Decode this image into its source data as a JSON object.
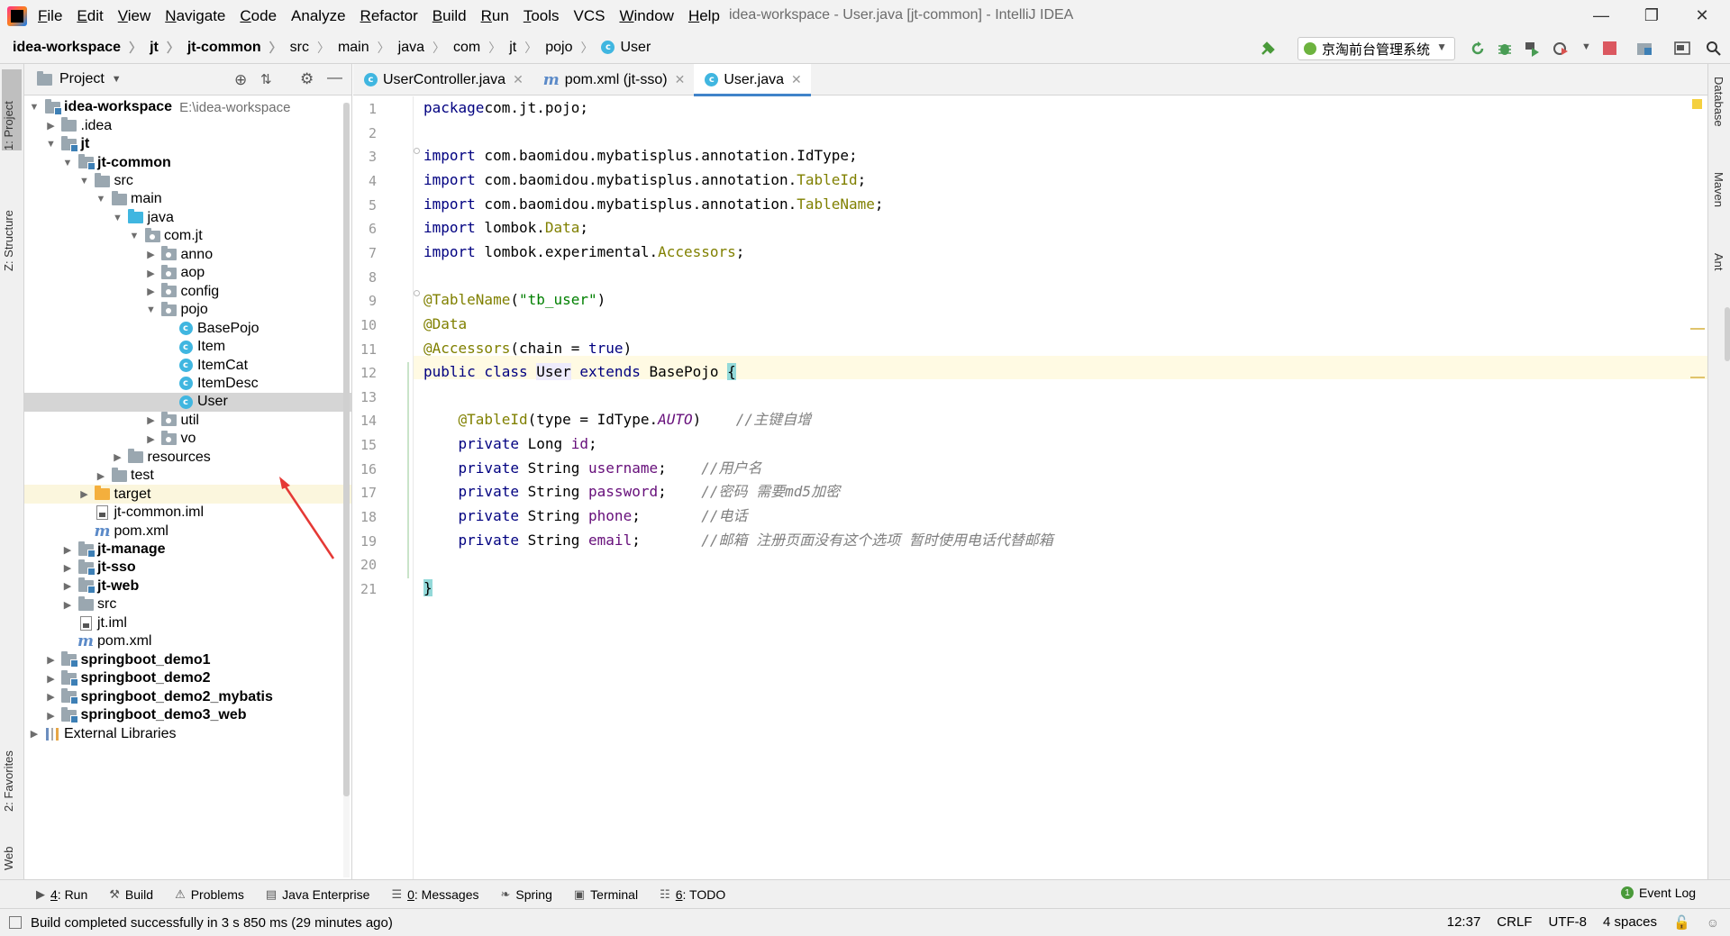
{
  "menubar": {
    "items": [
      {
        "u": "F",
        "rest": "ile"
      },
      {
        "u": "E",
        "rest": "dit"
      },
      {
        "u": "V",
        "rest": "iew"
      },
      {
        "u": "N",
        "rest": "avigate"
      },
      {
        "u": "C",
        "rest": "ode"
      },
      {
        "u": "",
        "rest": "Analyze"
      },
      {
        "u": "R",
        "rest": "efactor"
      },
      {
        "u": "B",
        "rest": "uild"
      },
      {
        "u": "R",
        "rest": "un"
      },
      {
        "u": "T",
        "rest": "ools"
      },
      {
        "u": "",
        "rest": "VCS"
      },
      {
        "u": "W",
        "rest": "indow"
      },
      {
        "u": "H",
        "rest": "elp"
      }
    ],
    "window_title": "idea-workspace - User.java [jt-common] - IntelliJ IDEA"
  },
  "navbar": {
    "breadcrumbs": [
      "idea-workspace",
      "jt",
      "jt-common",
      "src",
      "main",
      "java",
      "com",
      "jt",
      "pojo",
      "User"
    ],
    "run_config": "京淘前台管理系统"
  },
  "left_strip": {
    "project": "1: Project",
    "structure": "Z: Structure",
    "favorites": "2: Favorites",
    "web": "Web"
  },
  "right_strip": {
    "database": "Database",
    "maven": "Maven",
    "ant": "Ant"
  },
  "project_panel": {
    "title": "Project",
    "tree": [
      {
        "label": "idea-workspace",
        "path": "E:\\idea-workspace",
        "bold": true,
        "depth": 0,
        "arrow": "open",
        "icon": "module"
      },
      {
        "label": ".idea",
        "depth": 1,
        "arrow": "closed",
        "icon": "folder"
      },
      {
        "label": "jt",
        "bold": true,
        "depth": 1,
        "arrow": "open",
        "icon": "module"
      },
      {
        "label": "jt-common",
        "bold": true,
        "depth": 2,
        "arrow": "open",
        "icon": "module"
      },
      {
        "label": "src",
        "depth": 3,
        "arrow": "open",
        "icon": "folder"
      },
      {
        "label": "main",
        "depth": 4,
        "arrow": "open",
        "icon": "folder"
      },
      {
        "label": "java",
        "depth": 5,
        "arrow": "open",
        "icon": "folder-blue"
      },
      {
        "label": "com.jt",
        "depth": 6,
        "arrow": "open",
        "icon": "package"
      },
      {
        "label": "anno",
        "depth": 7,
        "arrow": "closed",
        "icon": "package"
      },
      {
        "label": "aop",
        "depth": 7,
        "arrow": "closed",
        "icon": "package"
      },
      {
        "label": "config",
        "depth": 7,
        "arrow": "closed",
        "icon": "package"
      },
      {
        "label": "pojo",
        "depth": 7,
        "arrow": "open",
        "icon": "package"
      },
      {
        "label": "BasePojo",
        "depth": 8,
        "arrow": "",
        "icon": "class"
      },
      {
        "label": "Item",
        "depth": 8,
        "arrow": "",
        "icon": "class"
      },
      {
        "label": "ItemCat",
        "depth": 8,
        "arrow": "",
        "icon": "class"
      },
      {
        "label": "ItemDesc",
        "depth": 8,
        "arrow": "",
        "icon": "class"
      },
      {
        "label": "User",
        "depth": 8,
        "arrow": "",
        "icon": "class",
        "selected": true
      },
      {
        "label": "util",
        "depth": 7,
        "arrow": "closed",
        "icon": "package"
      },
      {
        "label": "vo",
        "depth": 7,
        "arrow": "closed",
        "icon": "package"
      },
      {
        "label": "resources",
        "depth": 5,
        "arrow": "closed",
        "icon": "folder"
      },
      {
        "label": "test",
        "depth": 4,
        "arrow": "closed",
        "icon": "folder"
      },
      {
        "label": "target",
        "depth": 3,
        "arrow": "closed",
        "icon": "folder-orange",
        "excluded": true
      },
      {
        "label": "jt-common.iml",
        "depth": 3,
        "arrow": "",
        "icon": "file"
      },
      {
        "label": "pom.xml",
        "depth": 3,
        "arrow": "",
        "icon": "maven"
      },
      {
        "label": "jt-manage",
        "bold": true,
        "depth": 2,
        "arrow": "closed",
        "icon": "module"
      },
      {
        "label": "jt-sso",
        "bold": true,
        "depth": 2,
        "arrow": "closed",
        "icon": "module"
      },
      {
        "label": "jt-web",
        "bold": true,
        "depth": 2,
        "arrow": "closed",
        "icon": "module"
      },
      {
        "label": "src",
        "depth": 2,
        "arrow": "closed",
        "icon": "folder"
      },
      {
        "label": "jt.iml",
        "depth": 2,
        "arrow": "",
        "icon": "file"
      },
      {
        "label": "pom.xml",
        "depth": 2,
        "arrow": "",
        "icon": "maven"
      },
      {
        "label": "springboot_demo1",
        "bold": true,
        "depth": 1,
        "arrow": "closed",
        "icon": "module"
      },
      {
        "label": "springboot_demo2",
        "bold": true,
        "depth": 1,
        "arrow": "closed",
        "icon": "module"
      },
      {
        "label": "springboot_demo2_mybatis",
        "bold": true,
        "depth": 1,
        "arrow": "closed",
        "icon": "module"
      },
      {
        "label": "springboot_demo3_web",
        "bold": true,
        "depth": 1,
        "arrow": "closed",
        "icon": "module"
      },
      {
        "label": "External Libraries",
        "depth": 0,
        "arrow": "closed",
        "icon": "library"
      }
    ]
  },
  "editor": {
    "tabs": [
      {
        "label": "UserController.java",
        "icon": "class",
        "active": false
      },
      {
        "label": "pom.xml (jt-sso)",
        "icon": "maven",
        "active": false
      },
      {
        "label": "User.java",
        "icon": "class",
        "active": true
      }
    ],
    "line_numbers": [
      "1",
      "2",
      "3",
      "4",
      "5",
      "6",
      "7",
      "8",
      "9",
      "10",
      "11",
      "12",
      "13",
      "14",
      "15",
      "16",
      "17",
      "18",
      "19",
      "20",
      "21"
    ],
    "lines": [
      [
        [
          "kw",
          "package"
        ],
        [
          "",
          "com.jt.pojo;"
        ]
      ],
      [],
      [
        [
          "kw",
          "import"
        ],
        [
          "",
          " com.baomidou.mybatisplus.annotation.IdType;"
        ]
      ],
      [
        [
          "kw",
          "import"
        ],
        [
          "",
          " com.baomidou.mybatisplus.annotation."
        ],
        [
          "ann",
          "TableId"
        ],
        [
          "",
          ";"
        ]
      ],
      [
        [
          "kw",
          "import"
        ],
        [
          "",
          " com.baomidou.mybatisplus.annotation."
        ],
        [
          "ann",
          "TableName"
        ],
        [
          "",
          ";"
        ]
      ],
      [
        [
          "kw",
          "import"
        ],
        [
          "",
          " lombok."
        ],
        [
          "ann",
          "Data"
        ],
        [
          "",
          ";"
        ]
      ],
      [
        [
          "kw",
          "import"
        ],
        [
          "",
          " lombok.experimental."
        ],
        [
          "ann",
          "Accessors"
        ],
        [
          "",
          ";"
        ]
      ],
      [],
      [
        [
          "ann",
          "@TableName"
        ],
        [
          "",
          "("
        ],
        [
          "str",
          "\"tb_user\""
        ],
        [
          "",
          ")"
        ]
      ],
      [
        [
          "ann",
          "@Data"
        ]
      ],
      [
        [
          "ann",
          "@Accessors"
        ],
        [
          "",
          "(chain = "
        ],
        [
          "kw",
          "true"
        ],
        [
          "",
          ")"
        ]
      ],
      [
        [
          "kw",
          "public class "
        ],
        [
          "hlcls",
          "User"
        ],
        [
          "kw",
          " extends "
        ],
        [
          "",
          "BasePojo "
        ],
        [
          "brace",
          "{"
        ]
      ],
      [],
      [
        [
          "",
          "    "
        ],
        [
          "ann",
          "@TableId"
        ],
        [
          "",
          "(type = IdType."
        ],
        [
          "cnst",
          "AUTO"
        ],
        [
          "",
          ")    "
        ],
        [
          "cmt",
          "//主键自增"
        ]
      ],
      [
        [
          "",
          "    "
        ],
        [
          "kw",
          "private "
        ],
        [
          "",
          "Long "
        ],
        [
          "fld",
          "id"
        ],
        [
          "",
          ";"
        ]
      ],
      [
        [
          "",
          "    "
        ],
        [
          "kw",
          "private "
        ],
        [
          "",
          "String "
        ],
        [
          "fld",
          "username"
        ],
        [
          "",
          ";    "
        ],
        [
          "cmt",
          "//用户名"
        ]
      ],
      [
        [
          "",
          "    "
        ],
        [
          "kw",
          "private "
        ],
        [
          "",
          "String "
        ],
        [
          "fld",
          "password"
        ],
        [
          "",
          ";    "
        ],
        [
          "cmt",
          "//密码 需要md5加密"
        ]
      ],
      [
        [
          "",
          "    "
        ],
        [
          "kw",
          "private "
        ],
        [
          "",
          "String "
        ],
        [
          "fld",
          "phone"
        ],
        [
          "",
          ";       "
        ],
        [
          "cmt",
          "//电话"
        ]
      ],
      [
        [
          "",
          "    "
        ],
        [
          "kw",
          "private "
        ],
        [
          "",
          "String "
        ],
        [
          "fld",
          "email"
        ],
        [
          "",
          ";       "
        ],
        [
          "cmt",
          "//邮箱 注册页面没有这个选项 暂时使用电话代替邮箱"
        ]
      ],
      [],
      [
        [
          "brace",
          "}"
        ]
      ]
    ]
  },
  "bottom_tabs": [
    {
      "icon": "run-icon",
      "u": "4",
      "rest": ": Run"
    },
    {
      "icon": "build-icon",
      "u": "",
      "rest": "Build"
    },
    {
      "icon": "problems-icon",
      "u": "",
      "rest": "Problems"
    },
    {
      "icon": "java-enterprise-icon",
      "u": "",
      "rest": "Java Enterprise"
    },
    {
      "icon": "messages-icon",
      "u": "0",
      "rest": ": Messages"
    },
    {
      "icon": "spring-icon",
      "u": "",
      "rest": "Spring"
    },
    {
      "icon": "terminal-icon",
      "u": "",
      "rest": "Terminal"
    },
    {
      "icon": "todo-icon",
      "u": "6",
      "rest": ": TODO"
    }
  ],
  "event_log": "Event Log",
  "status": {
    "message": "Build completed successfully in 3 s 850 ms (29 minutes ago)",
    "position": "12:37",
    "line_sep": "CRLF",
    "encoding": "UTF-8",
    "indent": "4 spaces"
  },
  "colors": {
    "accent": "#4083c9",
    "keyword": "#000080",
    "annotation": "#808000",
    "string": "#008000",
    "comment": "#808080",
    "field": "#660e7a"
  }
}
